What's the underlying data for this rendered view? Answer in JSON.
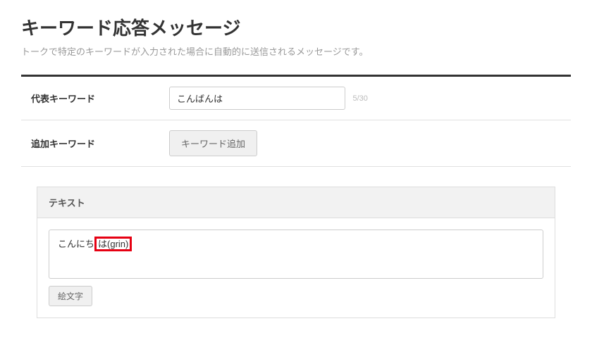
{
  "page": {
    "title": "キーワード応答メッセージ",
    "description": "トークで特定のキーワードが入力された場合に自動的に送信されるメッセージです。"
  },
  "form": {
    "representative_keyword": {
      "label": "代表キーワード",
      "value": "こんばんは",
      "char_count": "5/30"
    },
    "additional_keyword": {
      "label": "追加キーワード",
      "add_button_label": "キーワード追加"
    }
  },
  "text_section": {
    "header": "テキスト",
    "message_prefix": "こんにち",
    "message_highlighted": "は(grin)",
    "emoji_button_label": "絵文字"
  }
}
